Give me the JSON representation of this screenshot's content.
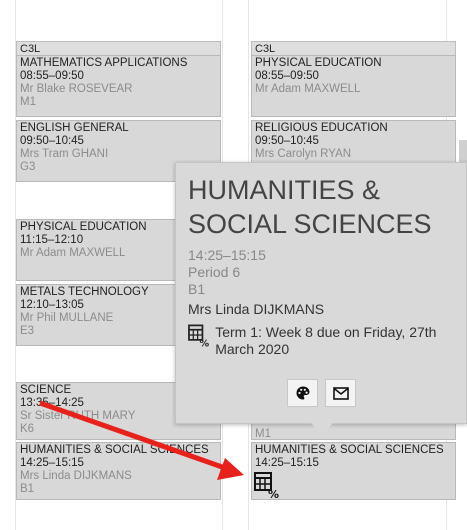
{
  "col1": {
    "head": "C3L",
    "blocks": [
      {
        "subject": "MATHEMATICS APPLICATIONS",
        "time": "08:55–09:50",
        "teacher": "Mr Blake ROSEVEAR",
        "room": "M1"
      },
      {
        "subject": "ENGLISH GENERAL",
        "time": "09:50–10:45",
        "teacher": "Mrs Tram GHANI",
        "room": "G3"
      },
      {
        "subject": "PHYSICAL EDUCATION",
        "time": "11:15–12:10",
        "teacher": "Mr Adam MAXWELL",
        "room": ""
      },
      {
        "subject": "METALS TECHNOLOGY",
        "time": "12:10–13:05",
        "teacher": "Mr Phil MULLANE",
        "room": "E3"
      },
      {
        "subject": "SCIENCE",
        "time": "13:35–14:25",
        "teacher": "Sr Sister RUTH MARY",
        "room": "K6"
      },
      {
        "subject": "HUMANITIES & SOCIAL SCIENCES",
        "time": "14:25–15:15",
        "teacher": "Mrs Linda DIJKMANS",
        "room": "B1"
      }
    ]
  },
  "col2": {
    "head": "C3L",
    "blocks": [
      {
        "subject": "PHYSICAL EDUCATION",
        "time": "08:55–09:50",
        "teacher": "Mr Adam MAXWELL",
        "room": ""
      },
      {
        "subject": "RELIGIOUS EDUCATION",
        "time": "09:50–10:45",
        "teacher": "Mrs Carolyn RYAN",
        "room": ""
      },
      {
        "subject": "",
        "time": "",
        "teacher": "",
        "room": "M1"
      },
      {
        "subject": "HUMANITIES & SOCIAL SCIENCES",
        "time": "14:25–15:15",
        "teacher": "",
        "room": ""
      }
    ]
  },
  "popup": {
    "title": "HUMANITIES & SOCIAL SCIENCES",
    "time": "14:25–15:15",
    "period": "Period 6",
    "room": "B1",
    "teacher": "Mrs Linda DIJKMANS",
    "due": "Term 1: Week 8 due on Friday, 27th March 2020",
    "icons": [
      "homework-icon",
      "palette-icon",
      "mail-icon"
    ]
  },
  "colors": {
    "accent_arrow": "#e8221b",
    "block_bg": "#d8d8d8",
    "popup_bg": "#d9d9d9"
  }
}
